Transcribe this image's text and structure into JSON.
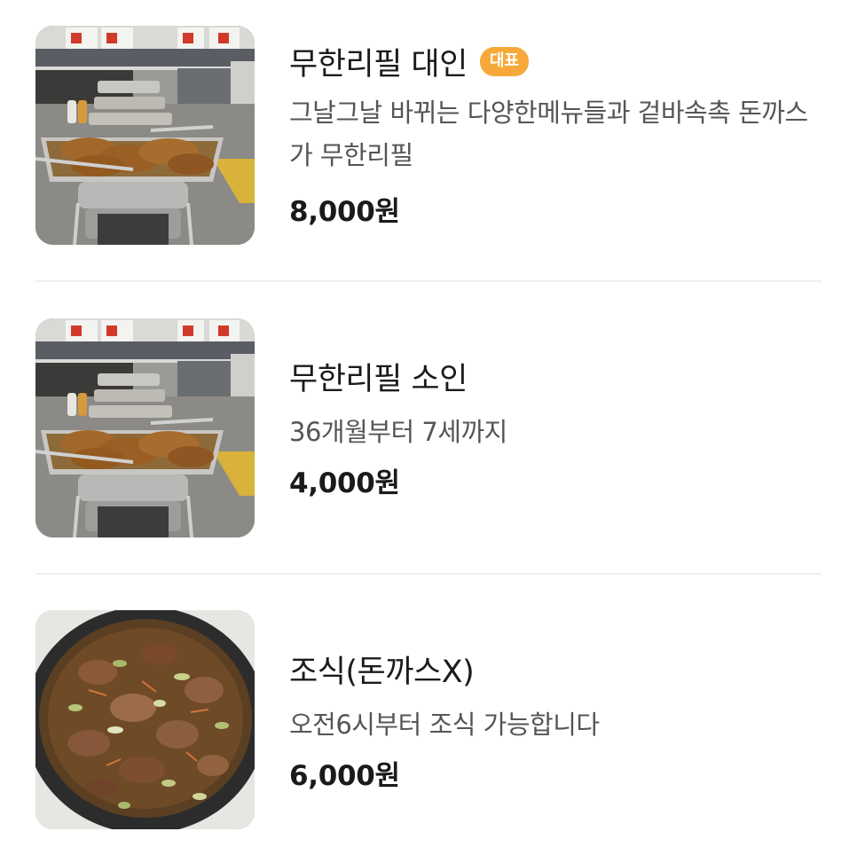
{
  "menu": {
    "items": [
      {
        "title": "무한리필 대인",
        "badge": "대표",
        "description": "그날그날 바뀌는 다양한메뉴들과 겉바속촉 돈까스가 무한리필",
        "price": "8,000원",
        "image": "buffet-tonkatsu-photo"
      },
      {
        "title": "무한리필 소인",
        "badge": "",
        "description": "36개월부터 7세까지",
        "price": "4,000원",
        "image": "buffet-tonkatsu-photo"
      },
      {
        "title": "조식(돈까스X)",
        "badge": "",
        "description": "오전6시부터 조식 가능합니다",
        "price": "6,000원",
        "image": "braised-meat-stew-photo"
      }
    ]
  },
  "colors": {
    "badge": "#f6a93a",
    "price": "#1a1a1a",
    "description": "#555555",
    "divider": "#eeeeee"
  }
}
